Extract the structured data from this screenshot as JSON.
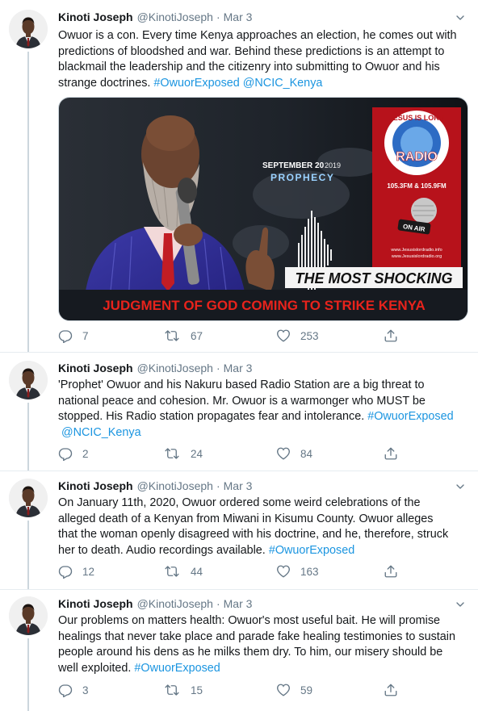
{
  "tweets": [
    {
      "name": "Kinoti Joseph",
      "handle": "@KinotiJoseph",
      "time": "Mar 3",
      "text_lines": [
        "Owuor is a con. Every time Kenya approaches an election, he comes out with",
        "predictions of bloodshed and war. Behind these predictions is an attempt to",
        "blackmail the leadership and the citizenry into submitting to Owuor and his",
        "strange doctrines."
      ],
      "hashtags": [
        "#OwuorExposed",
        "@NCIC_Kenya"
      ],
      "media": {
        "date_label": "SEPTEMBER 20",
        "year_label": "2019",
        "prophecy_label": "PROPHECY",
        "shocking_label": "THE MOST SHOCKING",
        "headline": "JUDGMENT OF GOD COMING TO STRIKE KENYA",
        "radio_top": "JESUS IS LORD",
        "radio_name": "RADIO",
        "frequencies": "105.3FM & 105.9FM",
        "on_air": "ON AIR",
        "site1": "www.Jesusislordradio.info",
        "site2": "www.Jesusislordradio.org"
      },
      "replies": "7",
      "retweets": "67",
      "likes": "253"
    },
    {
      "name": "Kinoti Joseph",
      "handle": "@KinotiJoseph",
      "time": "Mar 3",
      "text_lines": [
        "'Prophet' Owuor and his Nakuru based Radio Station are a big threat to",
        "national peace and cohesion. Mr. Owuor is a warmonger who MUST be",
        "stopped. His Radio station propagates fear and intolerance."
      ],
      "hashtags": [
        "#OwuorExposed",
        "@NCIC_Kenya"
      ],
      "replies": "2",
      "retweets": "24",
      "likes": "84"
    },
    {
      "name": "Kinoti Joseph",
      "handle": "@KinotiJoseph",
      "time": "Mar 3",
      "text_lines": [
        "On January 11th, 2020, Owuor ordered some weird celebrations of the",
        "alleged death of a Kenyan from Miwani in Kisumu County. Owuor alleges",
        "that the woman openly disagreed with his doctrine, and he, therefore, struck",
        "her to death. Audio recordings available."
      ],
      "hashtags": [
        "#OwuorExposed"
      ],
      "replies": "12",
      "retweets": "44",
      "likes": "163"
    },
    {
      "name": "Kinoti Joseph",
      "handle": "@KinotiJoseph",
      "time": "Mar 3",
      "text_lines": [
        "Our problems on matters health: Owuor's most useful bait. He will promise",
        "healings that never take place and parade fake healing testimonies to sustain",
        "people around his dens as he milks them dry. To him, our misery should be",
        "well exploited."
      ],
      "hashtags": [
        "#OwuorExposed"
      ],
      "replies": "3",
      "retweets": "15",
      "likes": "59"
    }
  ],
  "colors": {
    "link": "#1b95e0",
    "secondary_text": "#657786",
    "divider": "#e6ecf0",
    "thread_line": "#ccd6dd",
    "headline_red": "#e8231c"
  },
  "icons": [
    "chevron-down-icon",
    "reply-icon",
    "retweet-icon",
    "like-icon",
    "share-icon",
    "avatar"
  ]
}
